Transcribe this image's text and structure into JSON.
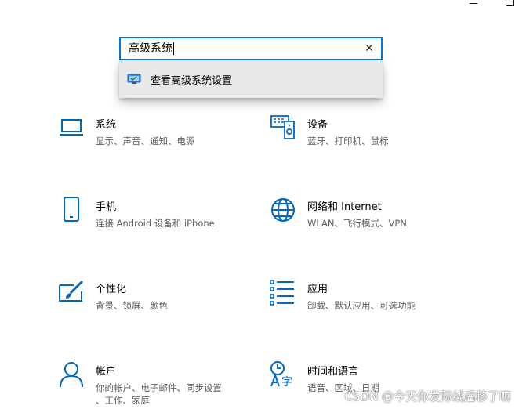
{
  "search": {
    "value": "高级系统",
    "suggestion": "查看高级系统设置"
  },
  "tiles": [
    {
      "title": "系统",
      "desc": [
        "显示、声音、通知、电源"
      ],
      "icon": "laptop-icon"
    },
    {
      "title": "设备",
      "desc": [
        "蓝牙、打印机、鼠标"
      ],
      "icon": "devices-icon"
    },
    {
      "title": "手机",
      "desc": [
        "连接 Android 设备和 iPhone"
      ],
      "icon": "phone-icon"
    },
    {
      "title": "网络和 Internet",
      "desc": [
        "WLAN、飞行模式、VPN"
      ],
      "icon": "globe-icon"
    },
    {
      "title": "个性化",
      "desc": [
        "背景、锁屏、颜色"
      ],
      "icon": "paint-icon"
    },
    {
      "title": "应用",
      "desc": [
        "卸载、默认应用、可选功能"
      ],
      "icon": "apps-list-icon"
    },
    {
      "title": "帐户",
      "desc": [
        "你的帐户、电子邮件、同步设置",
        "、工作、家庭"
      ],
      "icon": "person-icon"
    },
    {
      "title": "时间和语言",
      "desc": [
        "语音、区域、日期"
      ],
      "icon": "time-language-icon"
    }
  ],
  "watermark": "CSDN @今天你发际线后移了嘛",
  "colors": {
    "accent": "#0078d4",
    "icon": "#0067c0"
  }
}
